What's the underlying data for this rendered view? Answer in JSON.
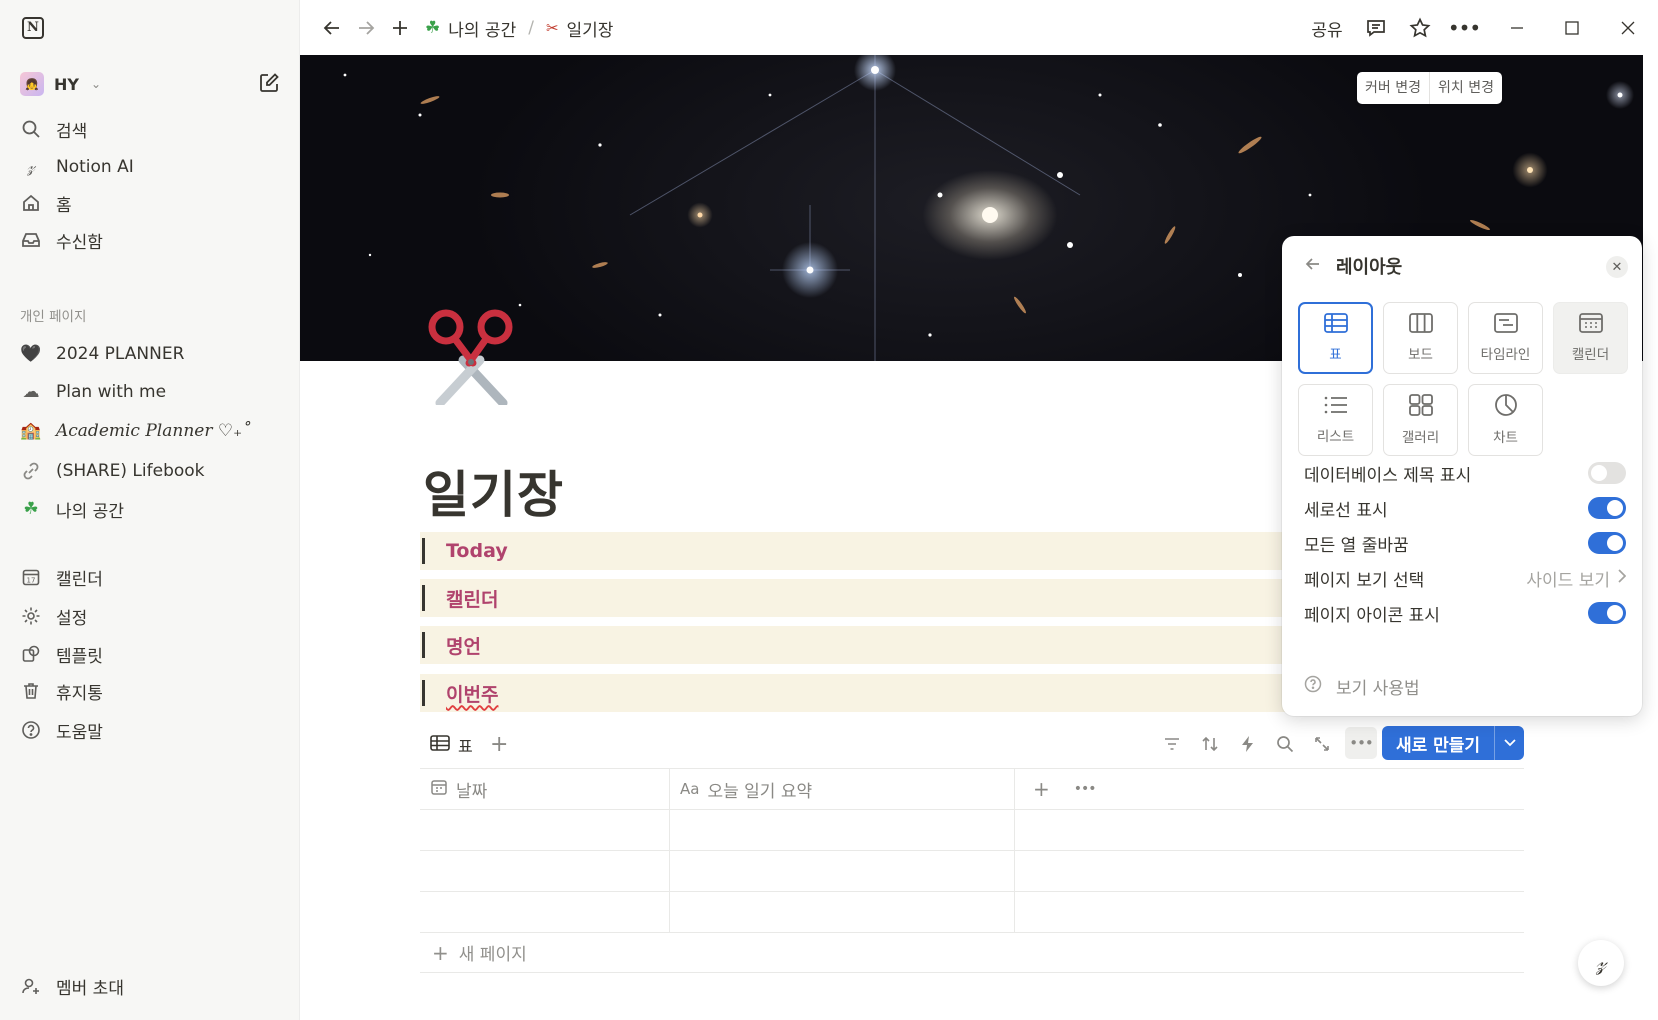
{
  "sidebar": {
    "workspace_name": "HY",
    "top_items": [
      {
        "label": "검색",
        "icon": "search-icon"
      },
      {
        "label": "Notion AI",
        "icon": "notion-ai-icon"
      },
      {
        "label": "홈",
        "icon": "home-icon"
      },
      {
        "label": "수신함",
        "icon": "inbox-icon"
      }
    ],
    "section_label": "개인 페이지",
    "pages": [
      {
        "label": "2024 PLANNER",
        "icon": "black-heart-icon"
      },
      {
        "label": "Plan with me",
        "icon": "cloud-icon"
      },
      {
        "label": "Academic Planner ♡₊˚",
        "icon": "school-icon"
      },
      {
        "label": "(SHARE) Lifebook",
        "icon": "link-icon"
      },
      {
        "label": "나의 공간",
        "icon": "clover-icon"
      }
    ],
    "bottom_items": [
      {
        "label": "캘린더",
        "icon": "calendar-icon"
      },
      {
        "label": "설정",
        "icon": "gear-icon"
      },
      {
        "label": "템플릿",
        "icon": "template-icon"
      },
      {
        "label": "휴지통",
        "icon": "trash-icon"
      },
      {
        "label": "도움말",
        "icon": "help-icon"
      }
    ],
    "invite_label": "멤버 초대"
  },
  "topbar": {
    "breadcrumb": [
      "나의 공간",
      "일기장"
    ],
    "separator": "/",
    "share_label": "공유"
  },
  "cover": {
    "change_cover": "커버 변경",
    "reposition": "위치 변경"
  },
  "page": {
    "title": "일기장",
    "callouts": [
      "Today",
      "캘린더",
      "명언",
      "이번주"
    ]
  },
  "database": {
    "view_label": "표",
    "new_button": "새로 만들기",
    "columns": [
      {
        "label": "날짜",
        "icon": "calendar-small-icon"
      },
      {
        "label": "오늘 일기 요약",
        "icon": "text-title-icon",
        "prefix": "Aa"
      }
    ],
    "rows": [
      [
        "",
        ""
      ],
      [
        "",
        ""
      ],
      [
        "",
        ""
      ]
    ],
    "new_page_label": "새 페이지"
  },
  "layout_panel": {
    "title": "레이아웃",
    "layouts": [
      {
        "label": "표",
        "icon": "table-icon",
        "selected": true
      },
      {
        "label": "보드",
        "icon": "board-icon"
      },
      {
        "label": "타임라인",
        "icon": "timeline-icon"
      },
      {
        "label": "캘린더",
        "icon": "calendar-icon"
      },
      {
        "label": "리스트",
        "icon": "list-icon"
      },
      {
        "label": "갤러리",
        "icon": "gallery-icon"
      },
      {
        "label": "차트",
        "icon": "chart-icon"
      }
    ],
    "options": [
      {
        "label": "데이터베이스 제목 표시",
        "toggle": false
      },
      {
        "label": "세로선 표시",
        "toggle": true
      },
      {
        "label": "모든 열 줄바꿈",
        "toggle": true
      },
      {
        "label": "페이지 보기 선택",
        "value": "사이드 보기"
      },
      {
        "label": "페이지 아이콘 표시",
        "toggle": true
      }
    ],
    "help_label": "보기 사용법"
  },
  "colors": {
    "accent": "#2f6fd8",
    "callout_bg": "#f8f3e3",
    "callout_text": "#b0436d",
    "sidebar_bg": "#f7f7f5"
  }
}
